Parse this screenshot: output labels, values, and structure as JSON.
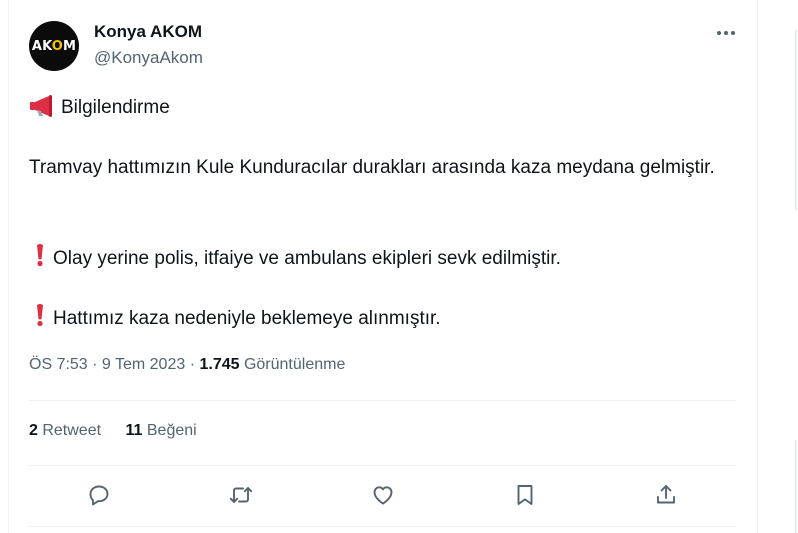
{
  "author": {
    "display_name": "Konya AKOM",
    "handle": "@KonyaAkom",
    "avatar_text_a": "AK",
    "avatar_text_o": "O",
    "avatar_text_m": "M"
  },
  "tweet": {
    "heading": "Bilgilendirme",
    "paragraph1": "Tramvay hattımızın  Kule  Kunduracılar durakları arasında kaza meydana gelmiştir.",
    "bullet1": "Olay yerine polis, itfaiye ve ambulans ekipleri sevk edilmiştir.",
    "bullet2": "Hattımız kaza nedeniyle beklemeye alınmıştır."
  },
  "meta": {
    "time": "ÖS 7:53",
    "separator1": " · ",
    "date": "9 Tem 2023",
    "separator2": " · ",
    "views_count": "1.745",
    "views_label": " Görüntülenme"
  },
  "stats": {
    "retweet_count": "2",
    "retweet_label": " Retweet",
    "like_count": "11",
    "like_label": " Beğeni"
  },
  "icons": {
    "megaphone": "megaphone-icon",
    "exclamation": "exclamation-icon",
    "more": "more-icon",
    "reply": "reply-icon",
    "retweet": "retweet-icon",
    "like": "heart-icon",
    "bookmark": "bookmark-icon",
    "share": "share-icon"
  },
  "colors": {
    "text": "#0f1419",
    "secondary": "#536471",
    "divider": "#eff3f4",
    "emoji_red": "#dd2e44"
  }
}
